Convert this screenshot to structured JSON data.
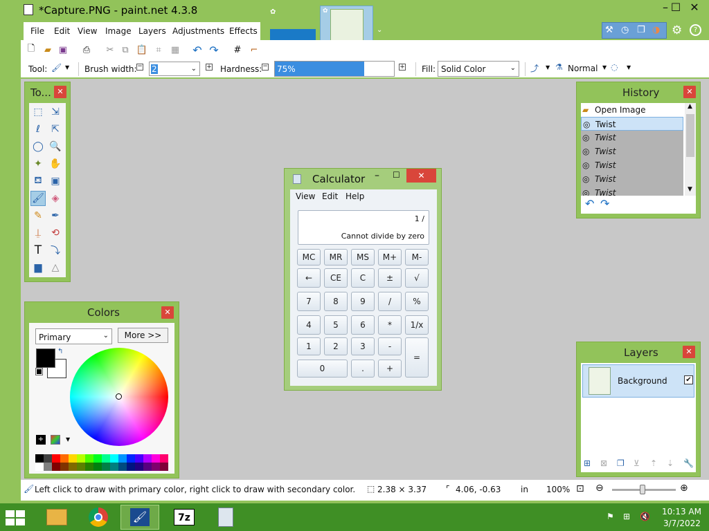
{
  "titlebar": {
    "title": "*Capture.PNG - paint.net 4.3.8",
    "minimize": "–",
    "maximize": "☐",
    "close": "✕"
  },
  "menu": [
    "File",
    "Edit",
    "View",
    "Image",
    "Layers",
    "Adjustments",
    "Effects"
  ],
  "toolbar": {
    "tool_label": "Tool:",
    "brush_width_label": "Brush width:",
    "brush_width_value": "2",
    "hardness_label": "Hardness:",
    "hardness_value": "75%",
    "hardness_fraction": 0.75,
    "fill_label": "Fill:",
    "fill_value": "Solid Color",
    "blend_value": "Normal"
  },
  "tools_panel": {
    "title": "To..."
  },
  "colors_panel": {
    "title": "Colors",
    "mode_value": "Primary",
    "more_button": "More >>"
  },
  "history_panel": {
    "title": "History",
    "items": [
      "Open Image",
      "Twist",
      "Twist",
      "Twist",
      "Twist",
      "Twist",
      "Twist"
    ]
  },
  "layers_panel": {
    "title": "Layers",
    "layer_name": "Background"
  },
  "calculator": {
    "title": "Calculator",
    "menu": [
      "View",
      "Edit",
      "Help"
    ],
    "display_top": "1 /",
    "display_main": "Cannot divide by zero",
    "row1": [
      "MC",
      "MR",
      "MS",
      "M+",
      "M-"
    ],
    "row2": [
      "←",
      "CE",
      "C",
      "±",
      "√"
    ],
    "row3": [
      "7",
      "8",
      "9",
      "/",
      "%"
    ],
    "row4": [
      "4",
      "5",
      "6",
      "*",
      "1/x"
    ],
    "row5": [
      "1",
      "2",
      "3",
      "-"
    ],
    "row6": [
      "0",
      ".",
      "+"
    ],
    "equals": "="
  },
  "statusbar": {
    "hint": "Left click to draw with primary color, right click to draw with secondary color.",
    "size": "2.38 × 3.37",
    "position": "4.06, -0.63",
    "units": "in",
    "zoom": "100%"
  },
  "taskbar": {
    "time": "10:13 AM",
    "date": "3/7/2022",
    "sevenzip": "7z"
  },
  "colors": {
    "accent": "#92c35a",
    "taskbar": "#3f8f25",
    "close": "#d9463a",
    "canvas": "#c8c8c8",
    "selected": "#cde3f7"
  }
}
